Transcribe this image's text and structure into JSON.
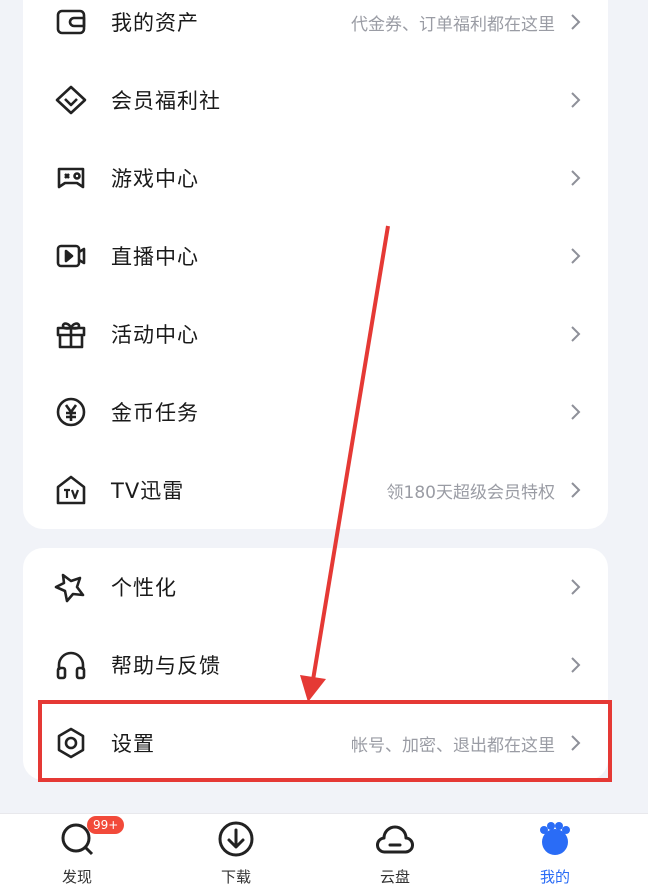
{
  "menu_card_1": {
    "items": [
      {
        "label": "我的资产",
        "hint": "代金券、订单福利都在这里",
        "icon": "wallet-icon"
      },
      {
        "label": "会员福利社",
        "hint": "",
        "icon": "diamond-icon"
      },
      {
        "label": "游戏中心",
        "hint": "",
        "icon": "gamepad-icon"
      },
      {
        "label": "直播中心",
        "hint": "",
        "icon": "live-video-icon"
      },
      {
        "label": "活动中心",
        "hint": "",
        "icon": "gift-icon"
      },
      {
        "label": "金币任务",
        "hint": "",
        "icon": "yen-coin-icon"
      },
      {
        "label": "TV迅雷",
        "hint": "领180天超级会员特权",
        "icon": "tv-house-icon"
      }
    ]
  },
  "menu_card_2": {
    "items": [
      {
        "label": "个性化",
        "hint": "",
        "icon": "star-shape-icon"
      },
      {
        "label": "帮助与反馈",
        "hint": "",
        "icon": "headphones-icon"
      },
      {
        "label": "设置",
        "hint": "帐号、加密、退出都在这里",
        "icon": "settings-icon"
      }
    ]
  },
  "bottom_nav": {
    "items": [
      {
        "label": "发现",
        "icon": "discover-icon",
        "badge": "99+"
      },
      {
        "label": "下载",
        "icon": "download-icon"
      },
      {
        "label": "云盘",
        "icon": "cloud-icon"
      },
      {
        "label": "我的",
        "icon": "profile-icon",
        "active": true
      }
    ]
  },
  "colors": {
    "accent": "#2a6cf6",
    "annotation": "#e53935",
    "badge": "#f24a3a",
    "background": "#f1f3f8"
  }
}
